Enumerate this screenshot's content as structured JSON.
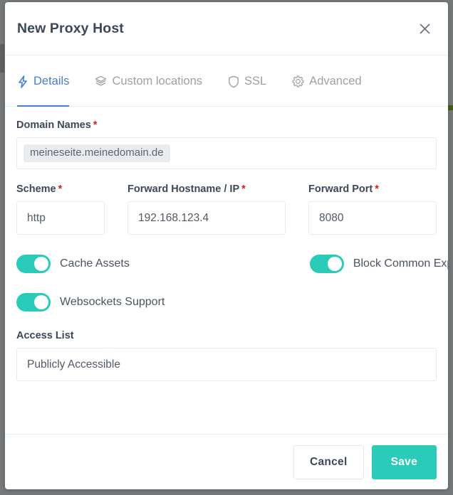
{
  "modal": {
    "title": "New Proxy Host",
    "close_icon": "close-icon"
  },
  "tabs": [
    {
      "label": "Details",
      "icon": "bolt-icon",
      "active": true
    },
    {
      "label": "Custom locations",
      "icon": "layers-icon",
      "active": false
    },
    {
      "label": "SSL",
      "icon": "shield-icon",
      "active": false
    },
    {
      "label": "Advanced",
      "icon": "gear-icon",
      "active": false
    }
  ],
  "form": {
    "domain_names": {
      "label": "Domain Names",
      "required_marker": "*",
      "tags": [
        "meineseite.meinedomain.de"
      ]
    },
    "scheme": {
      "label": "Scheme",
      "required_marker": "*",
      "value": "http"
    },
    "forward_hostname": {
      "label": "Forward Hostname / IP",
      "required_marker": "*",
      "value": "192.168.123.4"
    },
    "forward_port": {
      "label": "Forward Port",
      "required_marker": "*",
      "value": "8080"
    },
    "toggles": [
      {
        "label": "Cache Assets",
        "on": true
      },
      {
        "label": "Block Common Exploits",
        "on": true
      },
      {
        "label": "Websockets Support",
        "on": true
      }
    ],
    "access_list": {
      "label": "Access List",
      "value": "Publicly Accessible"
    }
  },
  "footer": {
    "cancel_label": "Cancel",
    "save_label": "Save"
  },
  "colors": {
    "accent_teal": "#2bcbba",
    "accent_blue": "#467fcf",
    "required_red": "#cd201f",
    "text_dark": "#3c4858",
    "text_muted": "#9aa0a6",
    "backdrop": "#76797a"
  }
}
